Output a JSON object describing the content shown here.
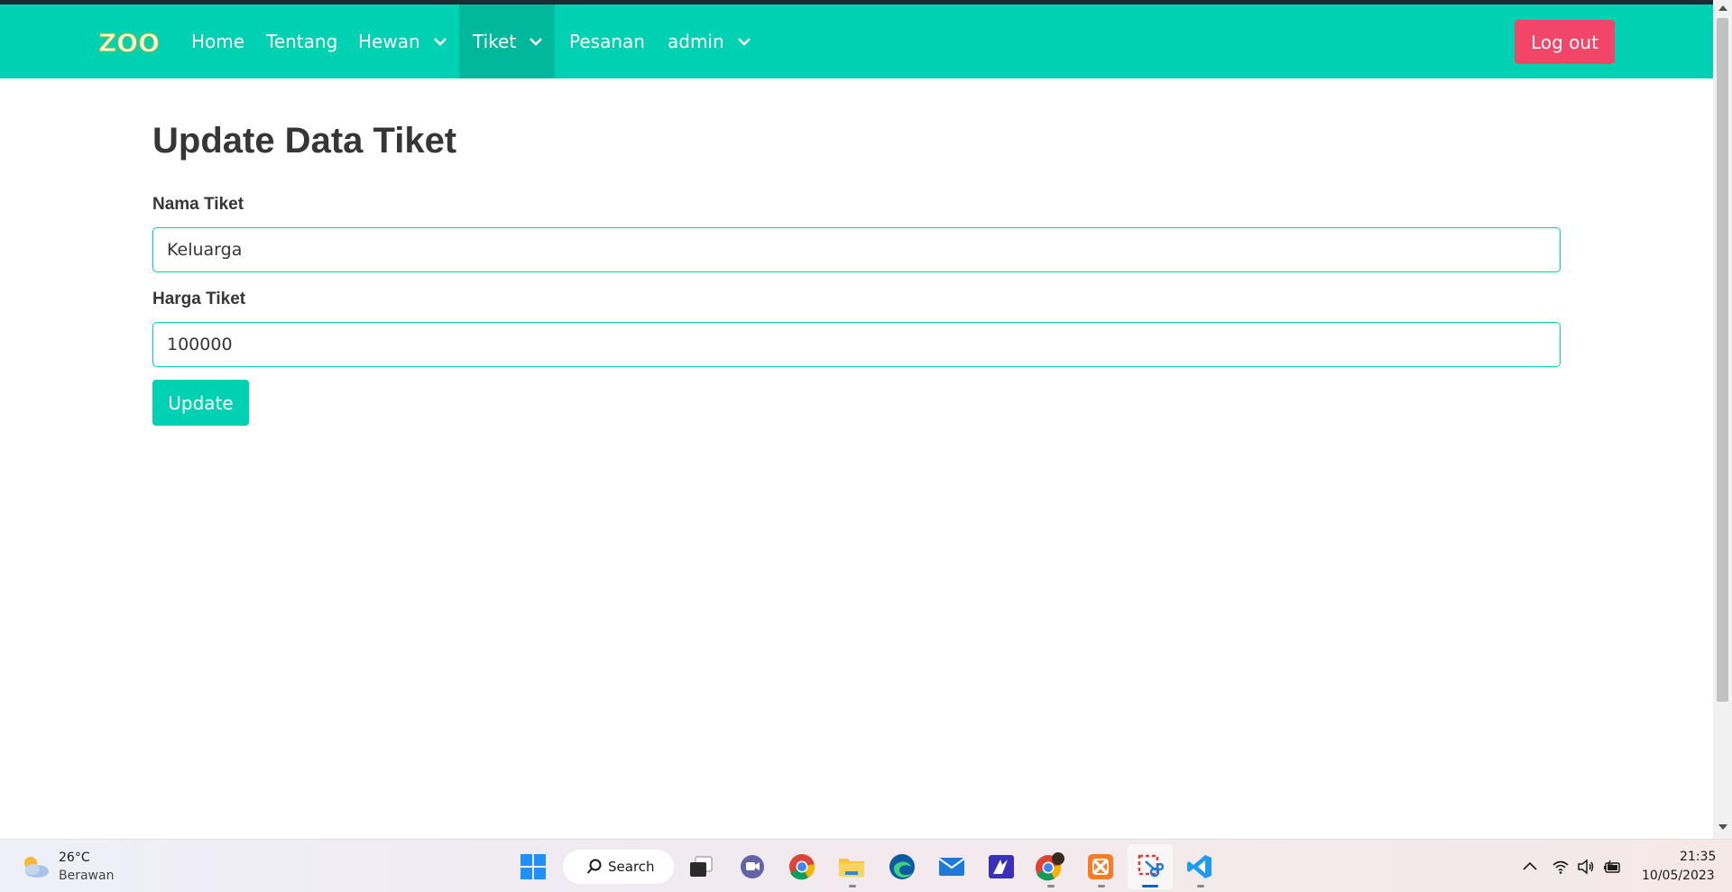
{
  "navbar": {
    "logo_text": "ZOO",
    "items": [
      {
        "label": "Home"
      },
      {
        "label": "Tentang"
      },
      {
        "label": "Hewan"
      },
      {
        "label": "Tiket"
      },
      {
        "label": "Pesanan"
      },
      {
        "label": "admin"
      }
    ],
    "logout_label": "Log out"
  },
  "page": {
    "title": "Update Data Tiket",
    "fields": [
      {
        "label": "Nama Tiket",
        "value": "Keluarga"
      },
      {
        "label": "Harga Tiket",
        "value": "100000"
      }
    ],
    "submit_label": "Update"
  },
  "taskbar": {
    "weather_temp": "26°C",
    "weather_desc": "Berawan",
    "search_label": "Search",
    "clock_time": "21:35",
    "clock_date": "10/05/2023",
    "apps": [
      "start-icon",
      "search",
      "task-view-icon",
      "chat-icon",
      "chrome-icon",
      "file-explorer-icon",
      "edge-icon",
      "mail-icon",
      "editor-icon",
      "chrome-profile-icon",
      "xampp-icon",
      "snipping-tool-icon",
      "vscode-icon"
    ]
  },
  "colors": {
    "primary": "#00d1b2",
    "primary_dark": "#00b89c",
    "danger": "#f14668",
    "text": "#363636"
  }
}
